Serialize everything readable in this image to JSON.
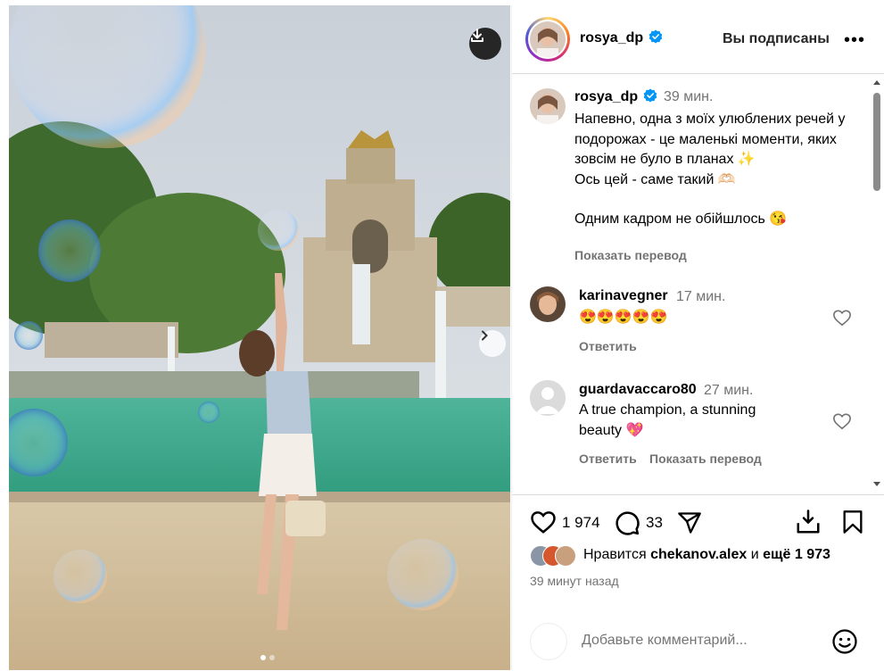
{
  "post": {
    "image_alt": "Woman reaching up among soap bubbles in front of Cascada fountain in Parc de la Ciutadella",
    "carousel_total": 2,
    "carousel_index": 1
  },
  "header": {
    "username": "rosya_dp",
    "follow_state": "Вы подписаны",
    "more_label": "•••"
  },
  "caption": {
    "username": "rosya_dp",
    "time": "39 мин.",
    "lines": [
      "Напевно, одна з моїх улюблених речей у подорожах - це маленькі моменти, яких зовсім не було в планах ✨",
      "Ось цей - саме такий 🫶🏻",
      "Одним кадром не обійшлось 😘"
    ],
    "translate_label": "Показать перевод"
  },
  "comments": [
    {
      "username": "karinavegner",
      "time": "17 мин.",
      "text": "😍😍😍😍😍",
      "reply_label": "Ответить"
    },
    {
      "username": "guardavaccaro80",
      "time": "27 мин.",
      "text": "A true champion, a stunning beauty 💖",
      "reply_label": "Ответить",
      "translate_label": "Показать перевод"
    }
  ],
  "actions": {
    "likes": "1 974",
    "comments": "33"
  },
  "likes": {
    "prefix": "Нравится",
    "user": "chekanov.alex",
    "middle": "и",
    "others": "ещё 1 973"
  },
  "posted_ago": "39 минут назад",
  "add_comment": {
    "placeholder": "Добавьте комментарий..."
  },
  "colors": {
    "verified": "#0095f6",
    "secondary_text": "#737373",
    "heart_red": "#ed4956"
  }
}
